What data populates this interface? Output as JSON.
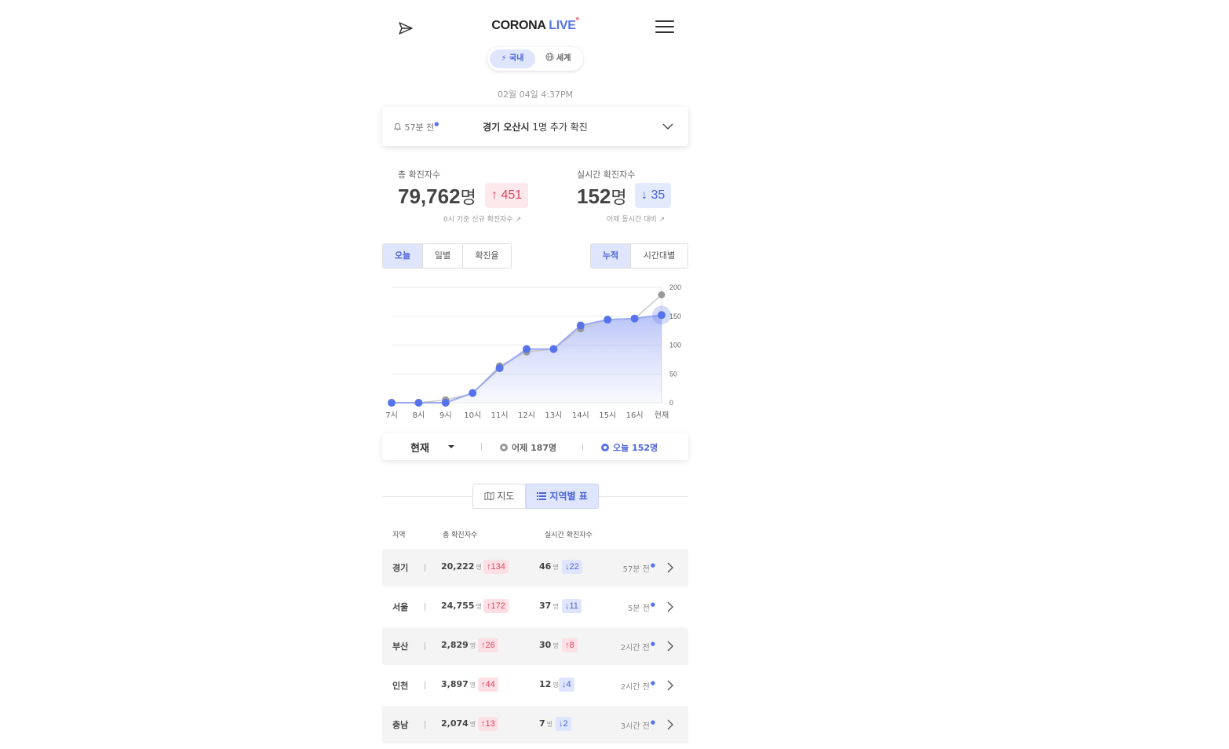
{
  "header": {
    "brand_main": "CORONA",
    "brand_live": "LIVE",
    "brand_dot": "*"
  },
  "region_toggle": {
    "domestic": "국내",
    "world": "세계",
    "selected": "국내"
  },
  "updated_at": "02월 04일 4:37PM",
  "alert": {
    "ago": "57분 전",
    "region": "경기 오산시",
    "text": "1명 추가 확진"
  },
  "stats": {
    "total": {
      "label": "총 확진자수",
      "value": "79,762",
      "unit": "명",
      "delta": "451",
      "note": "0시 기준 신규 확진자수"
    },
    "live": {
      "label": "실시간 확진자수",
      "value": "152",
      "unit": "명",
      "delta": "35",
      "note": "어제 동시간 대비"
    }
  },
  "chart_tabs": {
    "left": [
      "오늘",
      "일별",
      "확진율"
    ],
    "left_selected": "오늘",
    "right": [
      "누적",
      "시간대별"
    ],
    "right_selected": "누적"
  },
  "chart_data": {
    "type": "area",
    "x": [
      "7시",
      "8시",
      "9시",
      "10시",
      "11시",
      "12시",
      "13시",
      "14시",
      "15시",
      "16시",
      "현재"
    ],
    "ylim": [
      0,
      200
    ],
    "yticks": [
      0,
      50,
      100,
      150,
      200
    ],
    "series": [
      {
        "name": "어제",
        "values": [
          0,
          0,
          5,
          16,
          64,
          88,
          93,
          128,
          144,
          146,
          187
        ],
        "color": "#999999"
      },
      {
        "name": "오늘",
        "values": [
          0,
          0,
          0,
          17,
          60,
          93,
          93,
          134,
          144,
          146,
          152
        ],
        "color": "#5673EB"
      }
    ],
    "grid": true
  },
  "legend": {
    "select_label": "현재",
    "yesterday": "어제",
    "yesterday_value": "187명",
    "today": "오늘",
    "today_value": "152명"
  },
  "view_toggle": {
    "map": "지도",
    "table": "지역별 표",
    "selected": "지역별 표"
  },
  "table": {
    "headers": {
      "region": "지역",
      "total": "총 확진자수",
      "live": "실시간 확진자수"
    },
    "unit": "명",
    "rows": [
      {
        "region": "경기",
        "total": "20,222",
        "total_delta": "134",
        "live": "46",
        "live_delta": "22",
        "live_dir": "down",
        "ago": "57분 전"
      },
      {
        "region": "서울",
        "total": "24,755",
        "total_delta": "172",
        "live": "37",
        "live_delta": "11",
        "live_dir": "down",
        "ago": "5분 전"
      },
      {
        "region": "부산",
        "total": "2,829",
        "total_delta": "26",
        "live": "30",
        "live_delta": "8",
        "live_dir": "up",
        "ago": "2시간 전"
      },
      {
        "region": "인천",
        "total": "3,897",
        "total_delta": "44",
        "live": "12",
        "live_delta": "4",
        "live_dir": "down",
        "ago": "2시간 전"
      },
      {
        "region": "충남",
        "total": "2,074",
        "total_delta": "13",
        "live": "7",
        "live_delta": "2",
        "live_dir": "down",
        "ago": "3시간 전"
      }
    ]
  }
}
